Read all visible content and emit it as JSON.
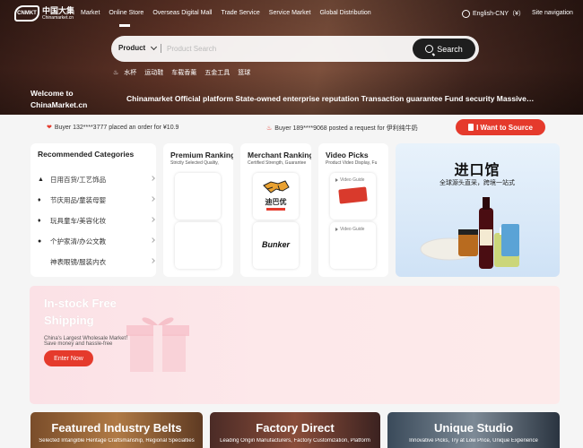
{
  "logo": {
    "mark": "CNMKT",
    "cn": "中国大集",
    "en": "Chinamarket.cn"
  },
  "nav": [
    "Market",
    "Online Store",
    "Overseas Digital Mall",
    "Trade Service",
    "Service Market",
    "Global Distribution"
  ],
  "lang": "English-CNY（¥）",
  "site_nav": "Site navigation",
  "search": {
    "category": "Product",
    "placeholder": "Product Search",
    "button": "Search"
  },
  "hot_keywords": [
    "水杯",
    "运动鞋",
    "车载香薰",
    "五金工具",
    "篮球"
  ],
  "welcome": [
    "Welcome to",
    "ChinaMarket.cn"
  ],
  "slogan": "Chinamarket Official platform State-owned enterprise reputation Transaction guarantee Fund security Massive…",
  "ticker": [
    "Buyer 132****3777 placed an order for ¥10.9",
    "Buyer 189****9068 posted a request for 伊利纯牛奶"
  ],
  "source_button": "I Want to Source",
  "categories": {
    "title": "Recommended Categories",
    "items": [
      "日用百货/工艺饰品",
      "节庆用品/童装母婴",
      "玩具童车/美容化妆",
      "个护家清/办公文教",
      "神表眼镜/服装内衣"
    ]
  },
  "premium": {
    "title": "Premium Ranking",
    "subtitle": "Strictly Selected Quality,"
  },
  "merchant": {
    "title": "Merchant Ranking",
    "subtitle": "Certified Strength, Guarantee",
    "brands": [
      "迪巴优",
      "Bunker"
    ]
  },
  "video": {
    "title": "Video Picks",
    "subtitle": "Product Video Display, Fu",
    "tag": "Video Guide"
  },
  "import": {
    "title": "进口馆",
    "subtitle": "全球源头直采，跨境一站式"
  },
  "free_ship": {
    "title_line1": "In-stock Free",
    "title_line2": "Shipping",
    "line1": "China's Largest Wholesale Market！",
    "line2": "Save money and hassle-free",
    "button": "Enter Now"
  },
  "bottom": [
    {
      "title": "Featured Industry Belts",
      "subtitle": "Selected Intangible Heritage Craftsmanship, Regional Specialties"
    },
    {
      "title": "Factory Direct",
      "subtitle": "Leading Origin Manufacturers, Factory Customization, Platform"
    },
    {
      "title": "Unique Studio",
      "subtitle": "Innovative Picks, Try at Low Price, Unique Experience"
    }
  ],
  "colors": {
    "accent": "#e53a2c",
    "dark": "#1e1e1e"
  }
}
